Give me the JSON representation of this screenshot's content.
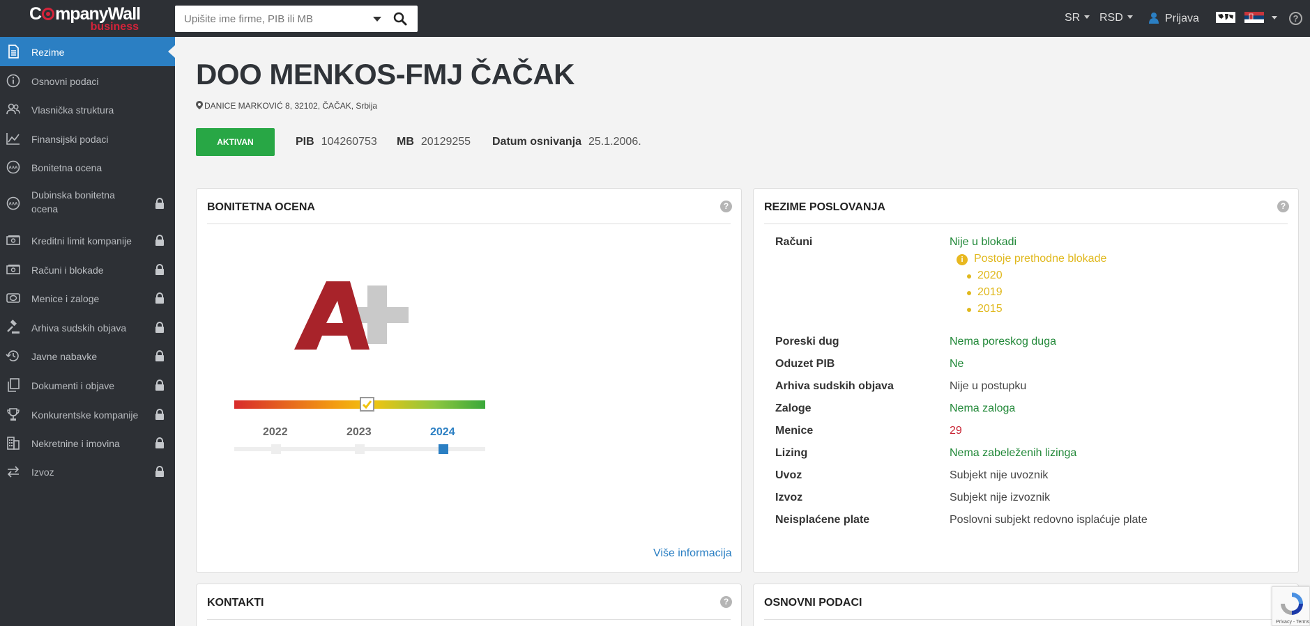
{
  "header": {
    "logo_main_1": "C",
    "logo_main_2": "mpanyWall",
    "logo_sub": "business",
    "search_placeholder": "Upišite ime firme, PIB ili MB",
    "lang": "SR",
    "currency": "RSD",
    "login": "Prijava",
    "help": "?"
  },
  "sidebar": {
    "items": [
      {
        "label": "Rezime",
        "icon": "document-icon",
        "locked": false,
        "active": true
      },
      {
        "label": "Osnovni podaci",
        "icon": "info-icon",
        "locked": false
      },
      {
        "label": "Vlasnička struktura",
        "icon": "users-icon",
        "locked": false
      },
      {
        "label": "Finansijski podaci",
        "icon": "chart-line-icon",
        "locked": false
      },
      {
        "label": "Bonitetna ocena",
        "icon": "rating-icon",
        "locked": false
      },
      {
        "label": "Dubinska bonitetna ocena",
        "icon": "rating-icon",
        "locked": true
      },
      {
        "label": "Kreditni limit kompanije",
        "icon": "money-icon",
        "locked": true
      },
      {
        "label": "Računi i blokade",
        "icon": "money-icon",
        "locked": true
      },
      {
        "label": "Menice i zaloge",
        "icon": "bill-icon",
        "locked": true
      },
      {
        "label": "Arhiva sudskih objava",
        "icon": "gavel-icon",
        "locked": true
      },
      {
        "label": "Javne nabavke",
        "icon": "history-icon",
        "locked": true
      },
      {
        "label": "Dokumenti i objave",
        "icon": "copy-icon",
        "locked": true
      },
      {
        "label": "Konkurentske kompanije",
        "icon": "trophy-icon",
        "locked": true
      },
      {
        "label": "Nekretnine i imovina",
        "icon": "building-icon",
        "locked": true
      },
      {
        "label": "Izvoz",
        "icon": "exchange-icon",
        "locked": true
      }
    ]
  },
  "company": {
    "name": "DOO MENKOS-FMJ ČAČAK",
    "address": "DANICE MARKOVIĆ 8, 32102, ČAČAK, Srbija",
    "status": "AKTIVAN",
    "pib_label": "PIB",
    "pib": "104260753",
    "mb_label": "MB",
    "mb": "20129255",
    "founded_label": "Datum osnivanja",
    "founded": "25.1.2006."
  },
  "bonitet": {
    "title": "BONITETNA OCENA",
    "grade": "A+",
    "years": [
      "2022",
      "2023",
      "2024"
    ],
    "selected_year": "2024",
    "more": "Više informacija"
  },
  "rezime": {
    "title": "REZIME POSLOVANJA",
    "racuni_label": "Računi",
    "racuni_value": "Nije u blokadi",
    "blokade_note": "Postoje prethodne blokade",
    "blokade_years": [
      "2020",
      "2019",
      "2015"
    ],
    "rows": [
      {
        "label": "Poreski dug",
        "value": "Nema poreskog duga",
        "tone": "green"
      },
      {
        "label": "Oduzet PIB",
        "value": "Ne",
        "tone": "green"
      },
      {
        "label": "Arhiva sudskih objava",
        "value": "Nije u postupku",
        "tone": "neutral"
      },
      {
        "label": "Zaloge",
        "value": "Nema zaloga",
        "tone": "green"
      },
      {
        "label": "Menice",
        "value": "29",
        "tone": "red"
      },
      {
        "label": "Lizing",
        "value": "Nema zabeleženih lizinga",
        "tone": "green"
      },
      {
        "label": "Uvoz",
        "value": "Subjekt nije uvoznik",
        "tone": "neutral"
      },
      {
        "label": "Izvoz",
        "value": "Subjekt nije izvoznik",
        "tone": "neutral"
      },
      {
        "label": "Neisplaćene plate",
        "value": "Poslovni subjekt redovno isplaćuje plate",
        "tone": "neutral"
      }
    ]
  },
  "kontakti": {
    "title": "KONTAKTI"
  },
  "osnovni": {
    "title": "OSNOVNI PODACI"
  },
  "recaptcha": {
    "text": "Privacy - Terms"
  },
  "colors": {
    "accent": "#2b7fc3",
    "sidebar": "#2d3035",
    "success": "#28a745",
    "grade": "#a8232a"
  }
}
